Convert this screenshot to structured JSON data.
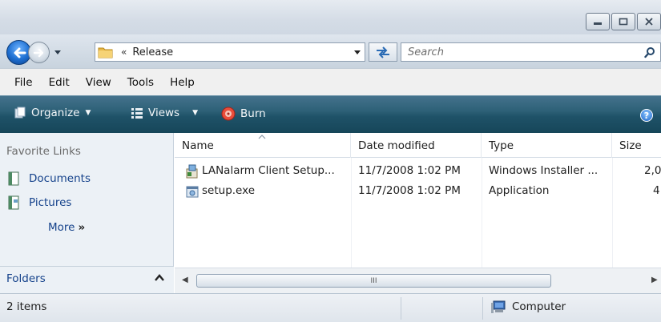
{
  "window": {
    "controls": {
      "minimize": "minimize",
      "maximize": "maximize",
      "close": "close"
    }
  },
  "address": {
    "chevron": "«",
    "path": "Release",
    "search_placeholder": "Search"
  },
  "menu": [
    "File",
    "Edit",
    "View",
    "Tools",
    "Help"
  ],
  "commands": {
    "organize": "Organize",
    "views": "Views",
    "burn": "Burn",
    "help": "?"
  },
  "nav": {
    "favorite_title": "Favorite Links",
    "links": [
      {
        "label": "Documents",
        "icon": "documents-icon"
      },
      {
        "label": "Pictures",
        "icon": "pictures-icon"
      }
    ],
    "more": "More",
    "more_glyph": "»",
    "folders": "Folders"
  },
  "columns": [
    "Name",
    "Date modified",
    "Type",
    "Size"
  ],
  "files": [
    {
      "name": "LANalarm Client Setup...",
      "date": "11/7/2008 1:02 PM",
      "type": "Windows Installer ...",
      "size": "2,0",
      "icon": "installer-icon"
    },
    {
      "name": "setup.exe",
      "date": "11/7/2008 1:02 PM",
      "type": "Application",
      "size": "4",
      "icon": "application-icon"
    }
  ],
  "scroll": {
    "grip": "III"
  },
  "status": {
    "items": "2 items",
    "location": "Computer"
  },
  "colors": {
    "command_bar": "#1f5268",
    "link": "#15428b",
    "nav_pane": "#ecf1f6"
  }
}
